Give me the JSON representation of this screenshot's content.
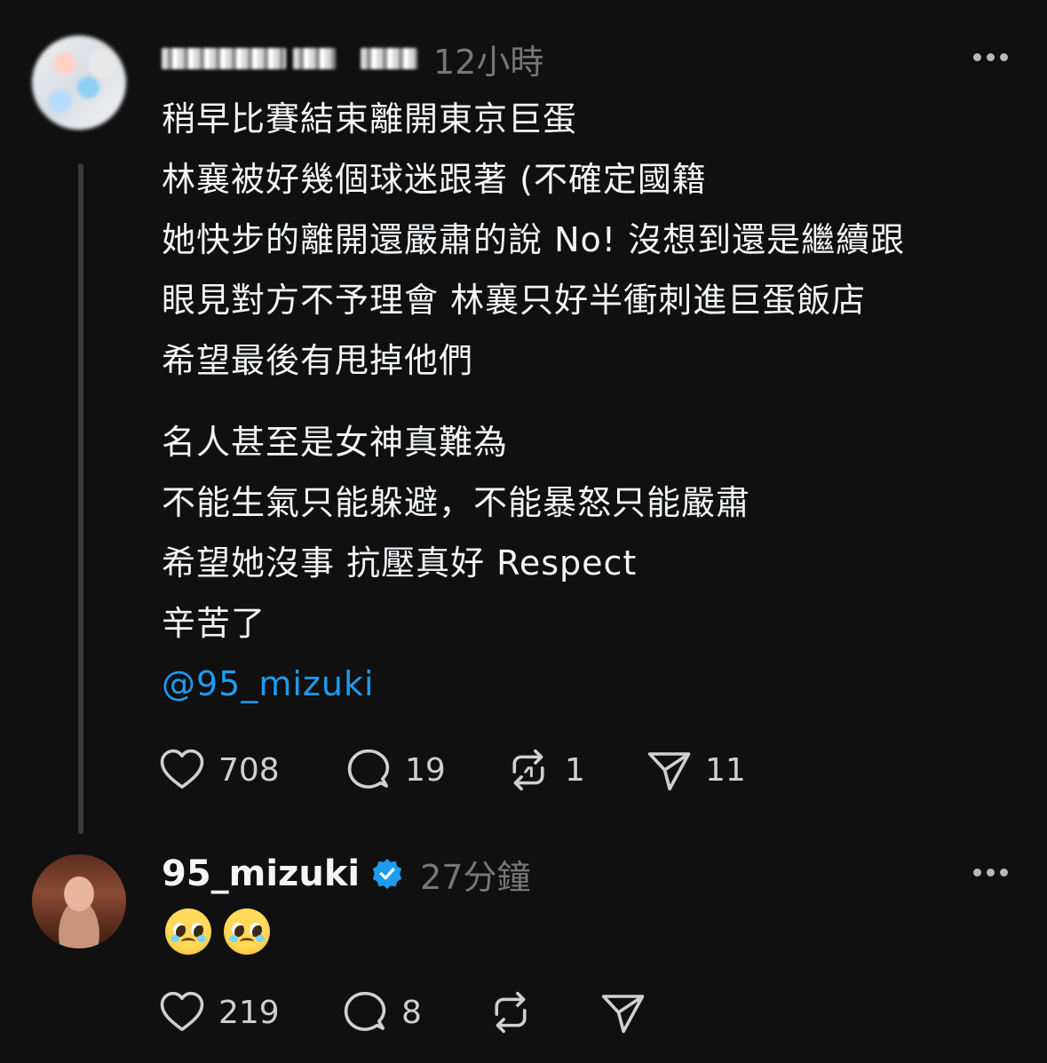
{
  "post1": {
    "time": "12小時",
    "lines": [
      "稍早比賽結束離開東京巨蛋",
      "林襄被好幾個球迷跟著 (不確定國籍",
      "她快步的離開還嚴肅的說 No! 沒想到還是繼續跟",
      "眼見對方不予理會 林襄只好半衝刺進巨蛋飯店",
      "希望最後有甩掉他們"
    ],
    "lines2": [
      "名人甚至是女神真難為",
      "不能生氣只能躲避，不能暴怒只能嚴肅",
      "希望她沒事 抗壓真好 Respect",
      "辛苦了"
    ],
    "mention": "@95_mizuki",
    "likes": "708",
    "comments": "19",
    "reposts": "1",
    "shares": "11"
  },
  "post2": {
    "username": "95_mizuki",
    "time": "27分鐘",
    "likes": "219",
    "comments": "8"
  },
  "icons": {
    "like": "heart-icon",
    "comment": "comment-bubble-icon",
    "repost": "repost-icon",
    "share": "send-icon",
    "more": "more-horizontal-icon",
    "verified": "verified-badge-icon"
  },
  "colors": {
    "background": "#101010",
    "text": "#f3f5f7",
    "muted": "#777777",
    "mention": "#1e9bf0",
    "verified": "#1e9bf0"
  }
}
